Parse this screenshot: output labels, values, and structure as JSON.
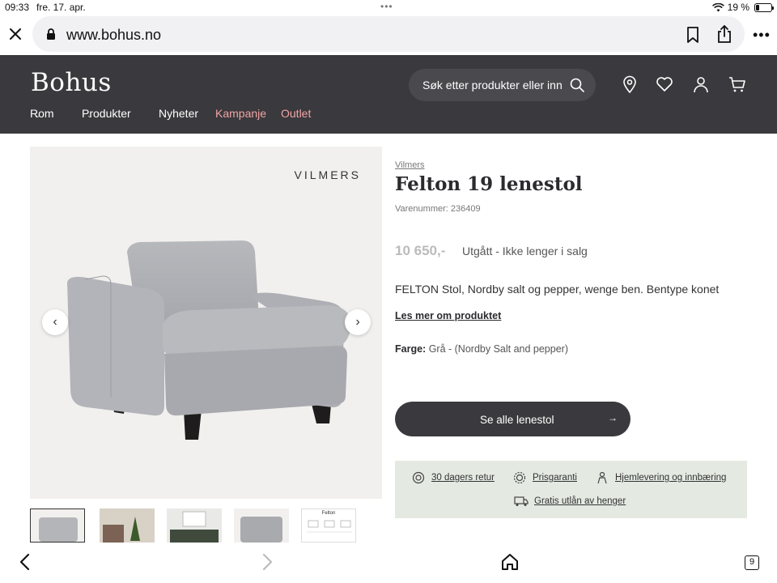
{
  "status_bar": {
    "time": "09:33",
    "date": "fre. 17. apr.",
    "battery": "19 %"
  },
  "browser": {
    "url": "www.bohus.no",
    "tab_count": "9"
  },
  "header": {
    "logo": "Bohus",
    "search_placeholder": "Søk etter produkter eller innl",
    "nav": [
      {
        "label": "Rom"
      },
      {
        "label": "Produkter"
      },
      {
        "label": "Nyheter"
      },
      {
        "label": "Kampanje"
      },
      {
        "label": "Outlet"
      }
    ]
  },
  "gallery": {
    "brand_mark": "VILMERS",
    "thumbnail_caption": "Felton"
  },
  "product": {
    "brand": "Vilmers",
    "title": "Felton 19 lenestol",
    "sku": "Varenummer: 236409",
    "price": "10 650,-",
    "availability": "Utgått - Ikke lenger i salg",
    "description": "FELTON Stol, Nordby salt og pepper, wenge ben. Bentype konet",
    "read_more": "Les mer om produktet",
    "color_label": "Farge:",
    "color_value": "Grå - (Nordby Salt and pepper)",
    "cta": "Se alle lenestol"
  },
  "usps": [
    {
      "label": "30 dagers retur",
      "icon": "return-icon"
    },
    {
      "label": "Prisgaranti",
      "icon": "price-guarantee-icon"
    },
    {
      "label": "Hjemlevering og innbæring",
      "icon": "delivery-person-icon"
    },
    {
      "label": "Gratis utlån av henger",
      "icon": "trailer-icon"
    }
  ],
  "colors": {
    "header_bg": "#3a393d",
    "accent_pink": "#f0a5a5",
    "usp_bg": "#e4e9e2",
    "gallery_bg": "#f2f0ee"
  }
}
